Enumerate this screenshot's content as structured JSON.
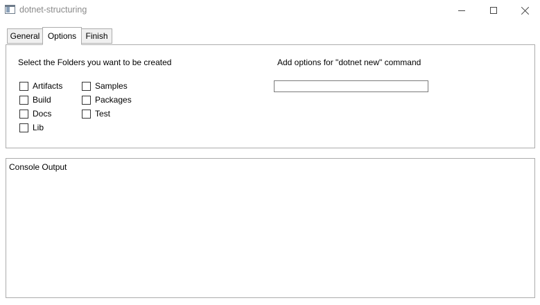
{
  "window": {
    "title": "dotnet-structuring",
    "icon": "app-window-icon"
  },
  "tabs": [
    {
      "label": "General",
      "selected": false
    },
    {
      "label": "Options",
      "selected": true
    },
    {
      "label": "Finish",
      "selected": false
    }
  ],
  "options": {
    "folders_label": "Select the Folders you want to be created",
    "folders": [
      {
        "label": "Artifacts",
        "checked": false
      },
      {
        "label": "Build",
        "checked": false
      },
      {
        "label": "Docs",
        "checked": false
      },
      {
        "label": "Lib",
        "checked": false
      },
      {
        "label": "Samples",
        "checked": false
      },
      {
        "label": "Packages",
        "checked": false
      },
      {
        "label": "Test",
        "checked": false
      }
    ],
    "command_label": "Add options for \"dotnet new\" command",
    "command_value": ""
  },
  "console": {
    "label": "Console Output"
  }
}
